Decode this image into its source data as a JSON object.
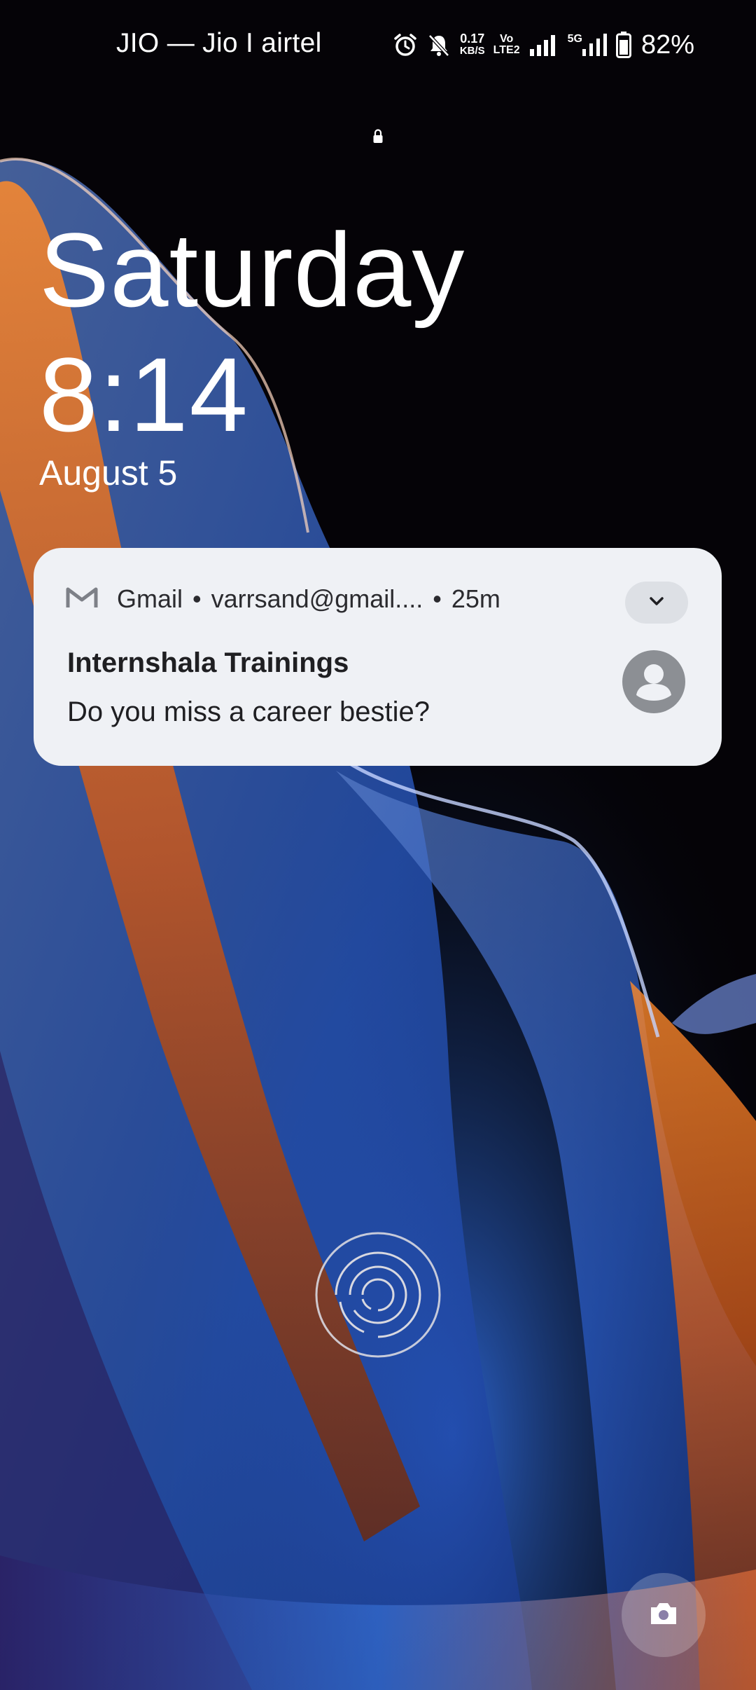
{
  "status_bar": {
    "carrier": "JIO — Jio I airtel",
    "network_speed": "0.17",
    "network_speed_unit": "KB/S",
    "volte_top": "Vo",
    "volte_bottom": "LTE2",
    "network_type": "5G",
    "battery_percent": "82%",
    "battery_level": 0.82,
    "icons": [
      "alarm-icon",
      "bell-off-icon",
      "signal-icon",
      "signal-5g-icon",
      "battery-icon"
    ]
  },
  "lockscreen": {
    "day": "Saturday",
    "time": "8:14",
    "date": "August 5"
  },
  "notification": {
    "app_name": "Gmail",
    "account": "varrsand@gmail....",
    "age": "25m",
    "title": "Internshala Trainings",
    "body": "Do you miss a career bestie?",
    "separator": "•"
  },
  "colors": {
    "card_background": "#eff1f5",
    "text_dark": "#1f1f22",
    "avatar": "#8c8f94"
  }
}
